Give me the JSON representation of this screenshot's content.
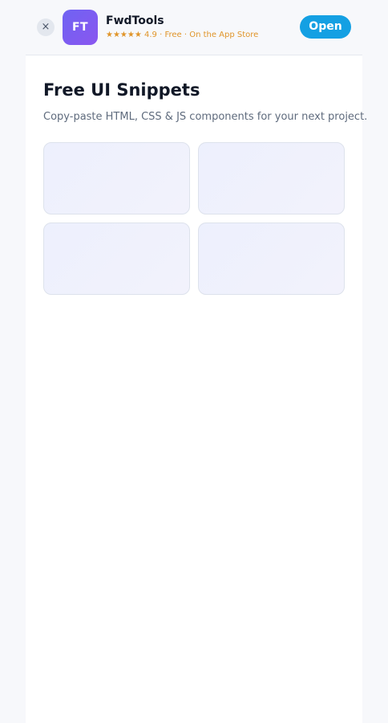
{
  "banner": {
    "close_label": "×",
    "icon_text": "FT",
    "app_name": "FwdTools",
    "meta": "★★★★★ 4.9 · Free · On the App Store",
    "open_label": "Open"
  },
  "main": {
    "title": "Free UI Snippets",
    "subtitle": "Copy-paste HTML, CSS & JS components for your next project."
  },
  "colors": {
    "accent": "#14a0e3",
    "app_icon": "#7a5cf1",
    "rating": "#e0952a"
  }
}
